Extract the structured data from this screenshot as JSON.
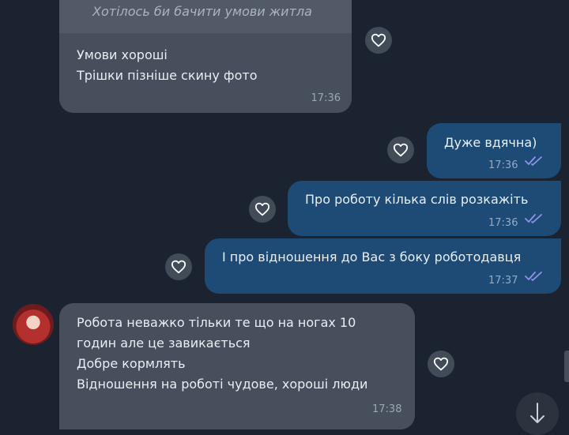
{
  "messages": [
    {
      "reply_quote": "Хотілось би бачити умови житла",
      "lines": [
        "Умови хороші",
        "Трішки пізніше скину фото"
      ],
      "time": "17:36"
    },
    {
      "lines": [
        "Дуже вдячна)"
      ],
      "time": "17:36"
    },
    {
      "lines": [
        "Про роботу кілька слів розкажіть"
      ],
      "time": "17:36"
    },
    {
      "lines": [
        "І про відношення до Вас з боку роботодавця"
      ],
      "time": "17:37"
    },
    {
      "lines": [
        "Робота неважко тільки те що на ногах 10",
        "годин але це завикається",
        "Добре кормлять",
        "Відношення на роботі чудове, хороші люди"
      ],
      "time": "17:38"
    }
  ],
  "icons": {
    "reaction": "heart-outline-icon",
    "read_status": "double-check-icon",
    "scroll": "arrow-down-icon"
  },
  "colors": {
    "background": "#1c2330",
    "incoming_bubble": "#474f5c",
    "outgoing_bubble": "#1d4b75",
    "read_ticks": "#8d93e8"
  }
}
